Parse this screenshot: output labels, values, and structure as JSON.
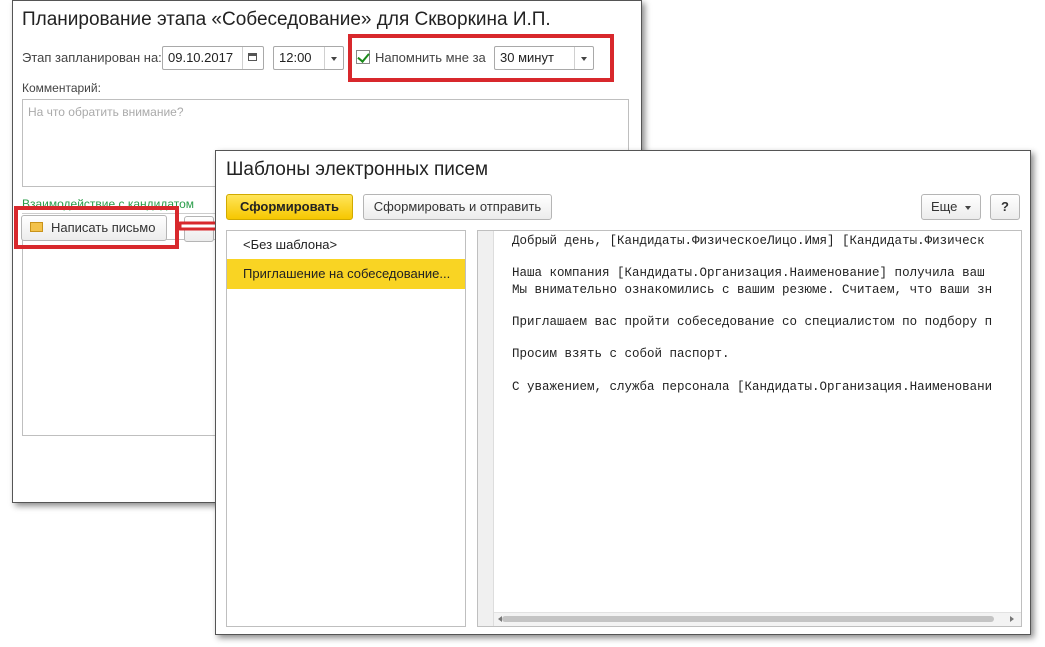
{
  "back_window": {
    "title": "Планирование этапа «Собеседование» для Скворкина И.П.",
    "planned_label": "Этап запланирован на:",
    "date_value": "09.10.2017",
    "time_value": "12:00",
    "remind_label": "Напомнить мне за",
    "remind_value": "30 минут",
    "comment_label": "Комментарий:",
    "comment_placeholder": "На что обратить внимание?",
    "interaction_label": "Взаимодействие с кандидатом",
    "write_letter_button": "Написать письмо"
  },
  "front_window": {
    "title": "Шаблоны электронных писем",
    "generate_button": "Сформировать",
    "generate_send_button": "Сформировать и отправить",
    "more_button": "Еще",
    "help_button": "?",
    "templates": [
      {
        "label": "<Без шаблона>",
        "selected": false
      },
      {
        "label": "Приглашение на собеседование...",
        "selected": true
      }
    ],
    "letter_lines": [
      "Добрый день, [Кандидаты.ФизическоеЛицо.Имя] [Кандидаты.Физическ",
      "",
      "Наша компания [Кандидаты.Организация.Наименование] получила ваш",
      "Мы внимательно ознакомились с вашим резюме. Считаем, что ваши зн",
      "",
      "Приглашаем вас пройти собеседование со специалистом по подбору п",
      "",
      "Просим взять с собой паспорт.",
      "",
      "С уважением, служба персонала [Кандидаты.Организация.Наименовани"
    ]
  },
  "colors": {
    "highlight_red": "#d8282c",
    "selected_yellow": "#f9d423",
    "accent_green": "#2a9d4a"
  }
}
